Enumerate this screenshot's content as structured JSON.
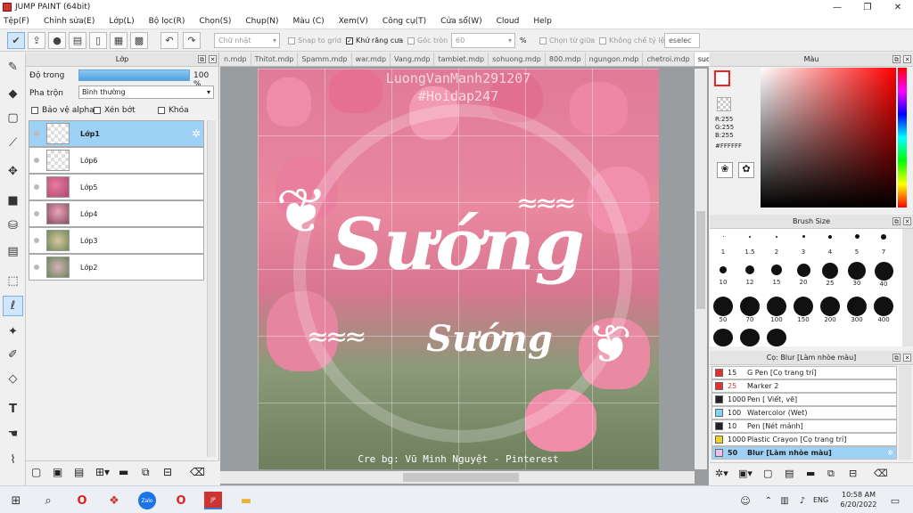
{
  "window": {
    "title": "JUMP PAINT (64bit)"
  },
  "menu": [
    "Tệp(F)",
    "Chỉnh sửa(E)",
    "Lớp(L)",
    "Bộ lọc(R)",
    "Chọn(S)",
    "Chụp(N)",
    "Màu (C)",
    "Xem(V)",
    "Công cụ(T)",
    "Cửa sổ(W)",
    "Cloud",
    "Help"
  ],
  "toolbar": {
    "shape_value": "Chữ nhật",
    "snap_label": "Snap to grid",
    "antialias_label": "Khử răng cưa",
    "corner_label": "Góc tròn",
    "corner_value": "60",
    "percent": "%",
    "select_middle_label": "Chọn từ giữa",
    "no_limit_label": "Không chế tỷ lệ",
    "deselect_label": "eselec"
  },
  "layers": {
    "title": "Lớp",
    "opacity_label": "Độ trong",
    "opacity_value": "100 %",
    "blend_label": "Pha trộn",
    "blend_value": "Bình thường",
    "protect_alpha": "Bảo vệ alpha",
    "clip": "Xén bớt",
    "lock": "Khóa",
    "items": [
      {
        "name": "Lớp1"
      },
      {
        "name": "Lớp6"
      },
      {
        "name": "Lớp5"
      },
      {
        "name": "Lớp4"
      },
      {
        "name": "Lớp3"
      },
      {
        "name": "Lớp2"
      }
    ]
  },
  "tabs": [
    "n.mdp",
    "Thitot.mdp",
    "Spamm.mdp",
    "war.mdp",
    "Vang.mdp",
    "tambiet.mdp",
    "sohuong.mdp",
    "800.mdp",
    "ngungon.mdp",
    "chetroi.mdp",
    "suong.mdp"
  ],
  "artwork": {
    "watermark1": "LuongVanManh291207",
    "watermark2": "#Hoidap247",
    "big_text": "Sướng",
    "small_text": "Sướng",
    "credit": "Cre bg: Vũ Minh Nguyệt - Pinterest"
  },
  "color": {
    "title": "Màu",
    "r": "R:255",
    "g": "G:255",
    "b": "B:255",
    "hex": "#FFFFFF"
  },
  "brush_size": {
    "title": "Brush Size",
    "sizes": [
      "1",
      "1.5",
      "2",
      "3",
      "4",
      "5",
      "7",
      "10",
      "12",
      "15",
      "20",
      "25",
      "30",
      "40",
      "50",
      "70",
      "100",
      "150",
      "200",
      "300",
      "400"
    ]
  },
  "brushes": {
    "title": "Cọ: Blur [Làm nhòe màu]",
    "items": [
      {
        "size": "15",
        "name": "G Pen [Cọ trang trí]",
        "color": "#e53030"
      },
      {
        "size": "25",
        "name": "Marker 2",
        "color": "#e53030"
      },
      {
        "size": "1000",
        "name": "Pen [ Viết, vẽ]",
        "color": "#222222"
      },
      {
        "size": "100",
        "name": "Watercolor (Wet)",
        "color": "#7fd3f0"
      },
      {
        "size": "10",
        "name": "Pen [Nét mảnh]",
        "color": "#222222"
      },
      {
        "size": "1000",
        "name": "Plastic Crayon [Cọ trang trí]",
        "color": "#f0d020"
      },
      {
        "size": "50",
        "name": "Blur [Làm nhòe màu]",
        "color": "#f0c0e8"
      }
    ]
  },
  "taskbar": {
    "lang": "ENG",
    "time": "10:58 AM",
    "date": "6/20/2022"
  }
}
